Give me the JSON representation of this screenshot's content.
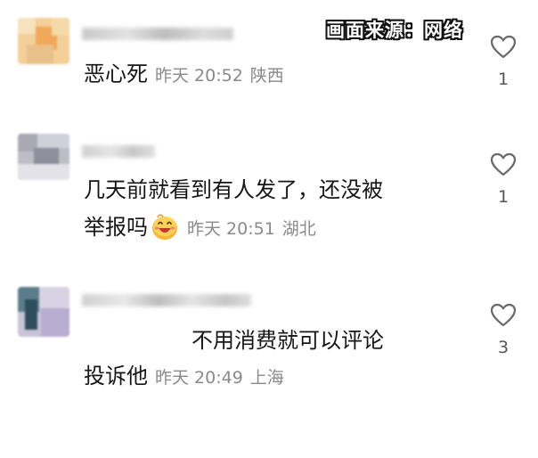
{
  "watermark": "画面来源：网络",
  "comments": [
    {
      "text_line1": "恶心死",
      "text_line2": "",
      "time": "昨天 20:52",
      "location": "陕西",
      "likes": "1"
    },
    {
      "text_line1": "几天前就看到有人发了，还没被",
      "text_line2": "举报吗",
      "time": "昨天 20:51",
      "location": "湖北",
      "likes": "1"
    },
    {
      "text_line1": "投诉他",
      "text_line2": "",
      "time": "昨天 20:49",
      "location": "上海",
      "likes": "3"
    }
  ],
  "overlay_caption": "不用消费就可以评论",
  "icons": [
    "heart-outline-icon",
    "laughing-emoji-icon"
  ],
  "colors": {
    "meta_text": "#8a8a8a",
    "like_count": "#555555"
  }
}
